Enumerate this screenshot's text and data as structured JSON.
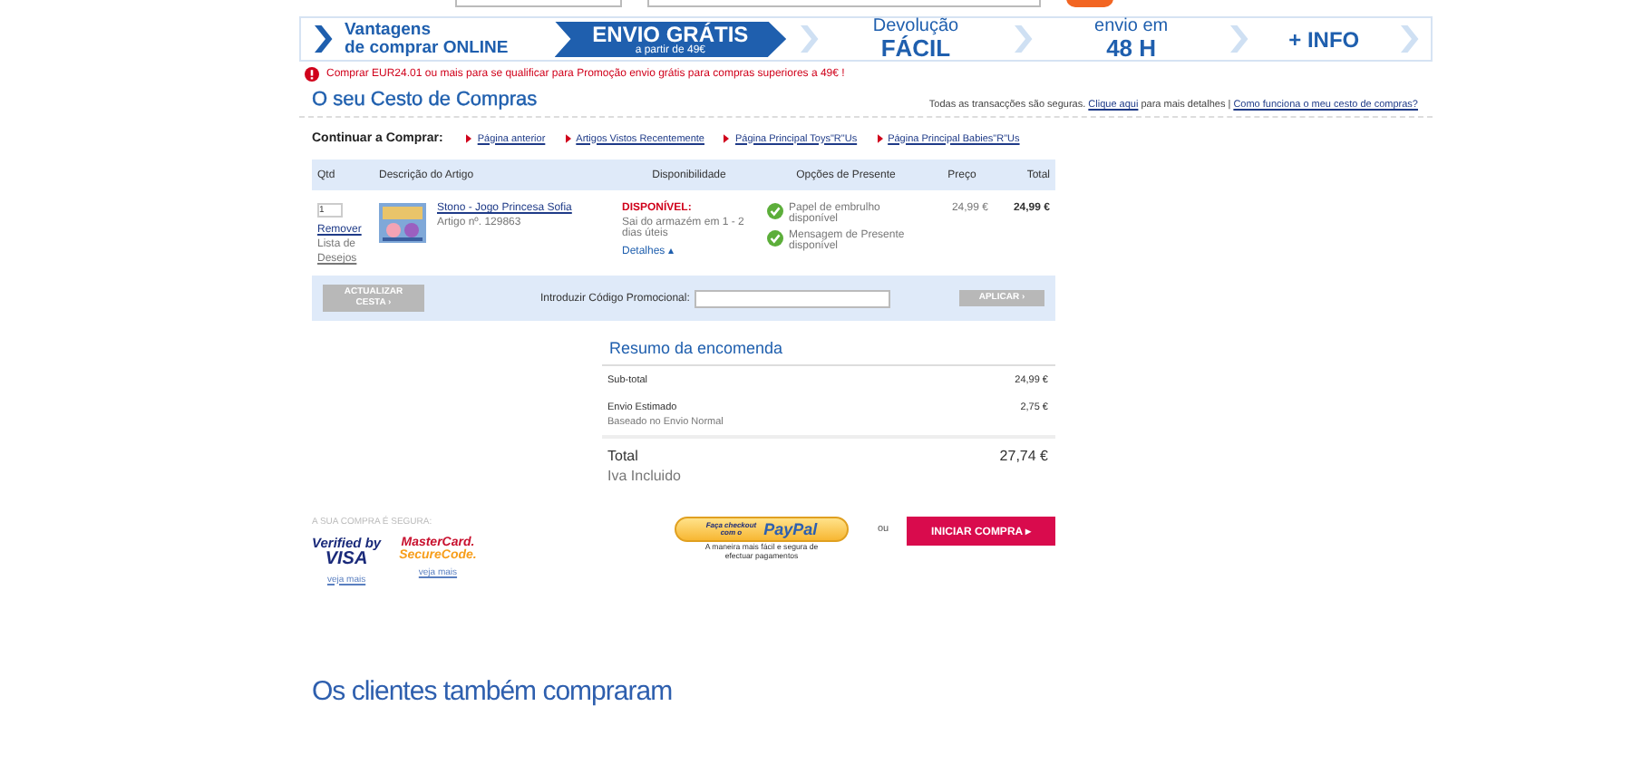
{
  "banner": [
    {
      "kind": "double",
      "line1": "Vantagens",
      "line2": "de comprar ONLINE"
    },
    {
      "kind": "highlight",
      "line1": "ENVIO GRÁTIS",
      "line2": "a partir de 49€"
    },
    {
      "kind": "double",
      "line1": "Devolução",
      "line2": "FÁCIL"
    },
    {
      "kind": "double",
      "line1": "envio em",
      "line2": "48 H"
    },
    {
      "kind": "single",
      "line1": "+ INFO"
    }
  ],
  "notice": "Comprar EUR24.01 ou mais para se qualificar para Promoção envio grátis para compras superiores a 49€ !",
  "title": "O seu Cesto de Compras",
  "secure_text": "Todas as transacções são seguras.",
  "secure_link": "Clique aqui",
  "secure_rest": "para mais detalhes |",
  "help_link": "Como funciona o meu cesto de compras?",
  "continue": {
    "label": "Continuar a Comprar:",
    "links": [
      "Página anterior",
      "Artigos Vistos Recentemente",
      "Página Principal Toys\"R\"Us",
      "Página Principal Babies\"R\"Us"
    ]
  },
  "table": {
    "columns": [
      "Qtd",
      "Descrição do Artigo",
      "Disponibilidade",
      "Opções de Presente",
      "Preço",
      "Total"
    ],
    "rows": [
      {
        "qty": "1",
        "remove": "Remover",
        "wishlist_label": "Lista de",
        "wishlist_link": "Desejos",
        "name": "Stono - Jogo Princesa Sofia",
        "article": "Artigo nº. 129863",
        "status": "DISPONÍVEL:",
        "availability": "Sai do armazém em 1 - 2 dias úteis",
        "details": "Detalhes ▴",
        "gift_options": [
          {
            "label": "Papel de embrulho disponível",
            "available": true
          },
          {
            "label": "Mensagem de Presente disponível",
            "available": true
          }
        ],
        "price": "24,99 €",
        "total": "24,99 €"
      }
    ]
  },
  "update_button": "ACTUALIZAR CESTA ›",
  "promo": {
    "label": "Introduzir Código Promocional:",
    "button": "APLICAR ›"
  },
  "summary": {
    "title": "Resumo da encomenda",
    "lines": [
      {
        "label": "Sub-total",
        "value": "24,99 €"
      },
      {
        "label": "Envio Estimado",
        "note": "Baseado no Envio Normal",
        "value": "2,75 €"
      }
    ],
    "total_label": "Total",
    "total_note": "Iva Incluido",
    "total": "27,74 €"
  },
  "security": {
    "label": "A SUA COMPRA É SEGURA:",
    "badges": [
      {
        "kind": "visa",
        "line1": "Verified by",
        "line2": "VISA",
        "link": "veja mais"
      },
      {
        "kind": "mastercard",
        "line1": "MasterCard.",
        "line2": "SecureCode.",
        "link": "veja mais"
      }
    ]
  },
  "paypal": {
    "prefix": "Faça checkout",
    "sub": "com o",
    "brand": "PayPal",
    "caption": "A maneira mais fácil e segura de efectuar pagamentos"
  },
  "or": "ou",
  "checkout": "INICIAR COMPRA ▸",
  "also_bought": "Os clientes também compraram"
}
